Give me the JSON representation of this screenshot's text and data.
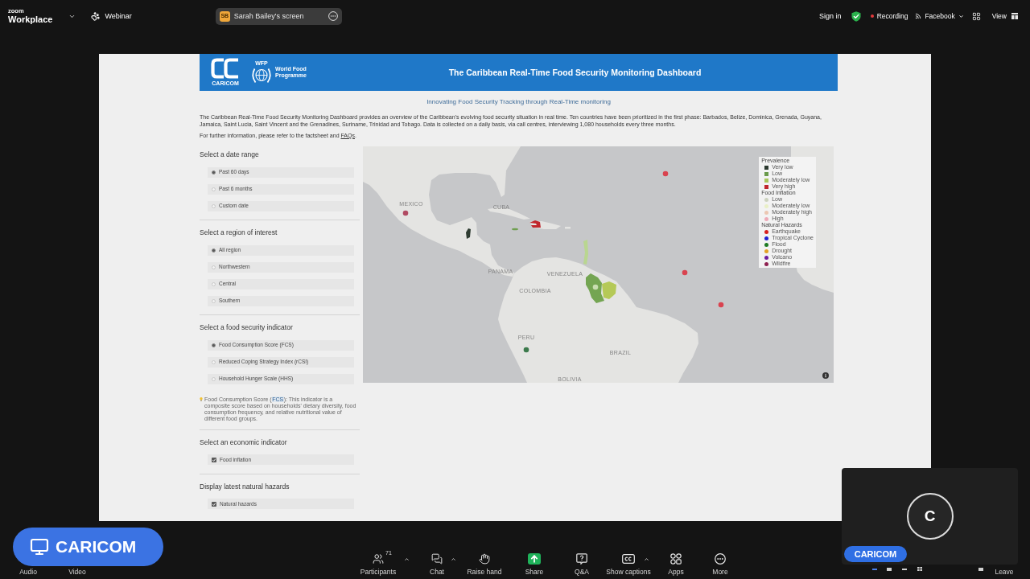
{
  "top_bar": {
    "brand_small": "zoom",
    "brand": "Workplace",
    "mode": "Webinar",
    "share_banner": {
      "initials": "SB",
      "label": "Sarah Bailey's screen"
    },
    "sign_in": "Sign in",
    "recording": "Recording",
    "livestream": "Facebook",
    "view": "View"
  },
  "shared_screen": {
    "header": {
      "caricom_label": "CARICOM",
      "wfp_short": "WFP",
      "wfp_name": "World Food Programme",
      "title": "The Caribbean Real-Time Food Security Monitoring Dashboard"
    },
    "subtitle": "Innovating Food Security Tracking through Real-Time monitoring",
    "description": "The Caribbean Real-Time Food Security Monitoring Dashboard provides an overview of the Caribbean's evolving food security situation in real time. Ten countries have been prioritized in the first phase: Barbados, Belize, Dominica, Grenada, Guyana, Jamaica, Saint Lucia, Saint Vincent and the Grenadines, Suriname, Trinidad and Tobago. Data is collected on a daily basis, via call centres, interviewing 1,080 households every three months.",
    "info": {
      "before": "For further information, please refer to the factsheet and ",
      "link": "FAQs",
      "after": "."
    },
    "filters": [
      {
        "heading": "Select a date range",
        "kind": "radio",
        "options": [
          {
            "label": "Past 60 days",
            "selected": true
          },
          {
            "label": "Past 6 months",
            "selected": false
          },
          {
            "label": "Custom date",
            "selected": false
          }
        ]
      },
      {
        "heading": "Select a region of interest",
        "kind": "radio",
        "options": [
          {
            "label": "All region",
            "selected": true
          },
          {
            "label": "Northwestern",
            "selected": false
          },
          {
            "label": "Central",
            "selected": false
          },
          {
            "label": "Southern",
            "selected": false
          }
        ]
      },
      {
        "heading": "Select a food security indicator",
        "kind": "radio",
        "options": [
          {
            "label": "Food Consumption Score (FCS)",
            "selected": true
          },
          {
            "label": "Reduced Coping Strategy Index (rCSI)",
            "selected": false
          },
          {
            "label": "Household Hunger Scale (HHS)",
            "selected": false
          }
        ],
        "note": {
          "before": "Food Consumption Score (",
          "link": "FCS",
          "after": "): This indicator is a composite score based on households' dietary diversity, food consumption frequency, and relative nutritional value of different food groups."
        }
      },
      {
        "heading": "Select an economic indicator",
        "kind": "checkbox",
        "options": [
          {
            "label": "Food inflation",
            "checked": true
          }
        ]
      },
      {
        "heading": "Display latest natural hazards",
        "kind": "checkbox",
        "options": [
          {
            "label": "Natural hazards",
            "checked": true
          }
        ]
      }
    ],
    "map": {
      "labels": [
        "MEXICO",
        "CUBA",
        "PANAMA",
        "VENEZUELA",
        "COLOMBIA",
        "PERU",
        "BRAZIL",
        "BOLIVIA"
      ],
      "shaded_countries": [
        {
          "color": "#2e3b31"
        },
        {
          "color": "#c0262c"
        },
        {
          "color": "#6e9f4f"
        },
        {
          "color": "#b9d690"
        },
        {
          "color": "#74a552"
        },
        {
          "color": "#b5c957"
        }
      ],
      "markers": [
        {
          "color": "#d9434f"
        },
        {
          "color": "#b04a62"
        },
        {
          "color": "#d9434f"
        },
        {
          "color": "#d9434f"
        },
        {
          "color": "#3c7a4c"
        },
        {
          "color": "#c8ddb0"
        }
      ],
      "legend": [
        {
          "title": "Prevalence",
          "kind": "square",
          "items": [
            {
              "label": "Very low",
              "color": "#2c3a2f"
            },
            {
              "label": "Low",
              "color": "#6a9a4b"
            },
            {
              "label": "Moderately low",
              "color": "#a8c75c"
            },
            {
              "label": "Very high",
              "color": "#c0272d"
            }
          ]
        },
        {
          "title": "Food Inflation",
          "kind": "circle",
          "items": [
            {
              "label": "Low",
              "color": "#cdd3bf"
            },
            {
              "label": "Moderately low",
              "color": "#e9f0c6"
            },
            {
              "label": "Moderately high",
              "color": "#ecc7b2"
            },
            {
              "label": "High",
              "color": "#eeaab8"
            }
          ]
        },
        {
          "title": "Natural Hazards",
          "kind": "circle",
          "items": [
            {
              "label": "Earthquake",
              "color": "#d8201f"
            },
            {
              "label": "Tropical Cyclone",
              "color": "#2020d0"
            },
            {
              "label": "Flood",
              "color": "#1d7a22"
            },
            {
              "label": "Drought",
              "color": "#e3a326"
            },
            {
              "label": "Volcano",
              "color": "#6e1d9e"
            },
            {
              "label": "Wildfire",
              "color": "#8e2050"
            }
          ]
        }
      ]
    }
  },
  "presenter_badge": "CARICOM",
  "video_tile": {
    "initial": "C",
    "name": "CARICOM"
  },
  "toolbar": [
    {
      "kind": "audio",
      "label": "Audio",
      "has_menu": false
    },
    {
      "kind": "video",
      "label": "Video",
      "has_menu": false
    },
    {
      "kind": "participants",
      "label": "Participants",
      "count": "71",
      "has_menu": true
    },
    {
      "kind": "chat",
      "label": "Chat",
      "has_menu": true
    },
    {
      "kind": "raise_hand",
      "label": "Raise hand",
      "has_menu": false
    },
    {
      "kind": "share",
      "label": "Share",
      "has_menu": false
    },
    {
      "kind": "qa",
      "label": "Q&A",
      "has_menu": false
    },
    {
      "kind": "captions",
      "label": "Show captions",
      "has_menu": true
    },
    {
      "kind": "apps",
      "label": "Apps",
      "has_menu": false
    },
    {
      "kind": "more",
      "label": "More",
      "has_menu": false
    },
    {
      "kind": "leave",
      "label": "Leave",
      "has_menu": false
    }
  ]
}
